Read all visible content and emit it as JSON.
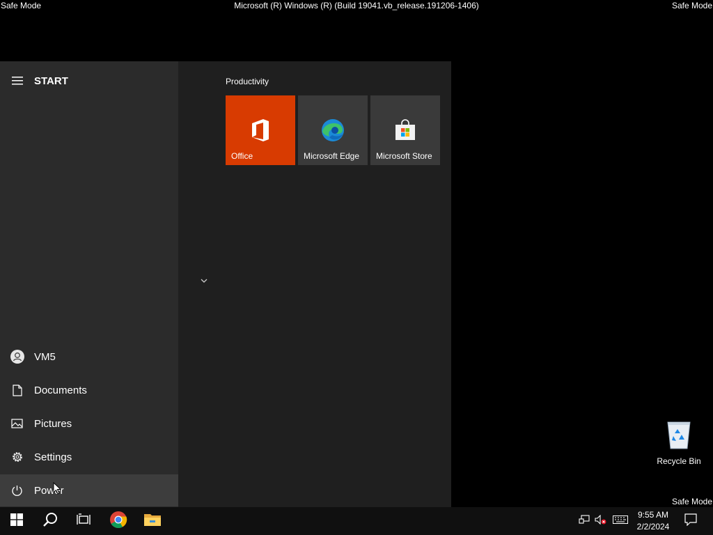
{
  "screen": {
    "safe_mode_label": "Safe Mode",
    "build_text": "Microsoft (R) Windows (R) (Build 19041.vb_release.191206-1406)"
  },
  "start_menu": {
    "header_label": "START",
    "group_title": "Productivity",
    "tiles": [
      {
        "label": "Office",
        "icon": "office-icon",
        "color": "#d83b01"
      },
      {
        "label": "Microsoft Edge",
        "icon": "edge-icon",
        "color": "#3a3a3a"
      },
      {
        "label": "Microsoft Store",
        "icon": "store-icon",
        "color": "#3a3a3a"
      }
    ],
    "left_items": {
      "user": {
        "label": "VM5",
        "icon": "user-icon"
      },
      "documents": {
        "label": "Documents",
        "icon": "document-icon"
      },
      "pictures": {
        "label": "Pictures",
        "icon": "pictures-icon"
      },
      "settings": {
        "label": "Settings",
        "icon": "gear-icon"
      },
      "power": {
        "label": "Power",
        "icon": "power-icon"
      }
    }
  },
  "desktop": {
    "recycle_bin_label": "Recycle Bin"
  },
  "taskbar": {
    "items": [
      "windows-start-icon",
      "search-icon",
      "task-view-icon",
      "chrome-icon",
      "file-explorer-icon"
    ],
    "clock": {
      "time": "9:55 AM",
      "date": "2/2/2024"
    },
    "tray": [
      "network-icon",
      "volume-muted-icon",
      "keyboard-icon",
      "notifications-icon"
    ]
  },
  "colors": {
    "office_tile": "#d83b01",
    "left_pane": "#2b2b2b",
    "tiles_pane": "#1f1f1f",
    "taskbar": "#101010"
  }
}
